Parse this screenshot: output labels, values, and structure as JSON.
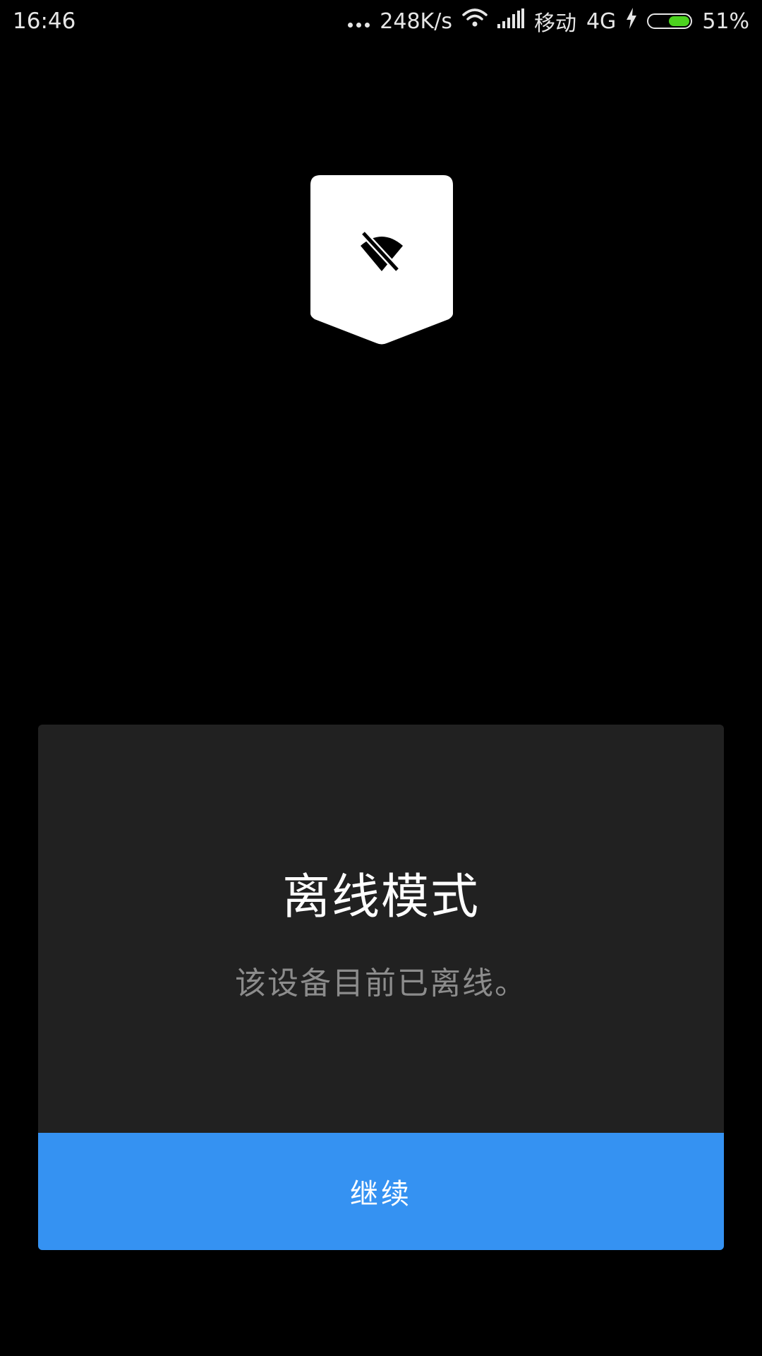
{
  "status_bar": {
    "time": "16:46",
    "network_speed": "248K/s",
    "carrier": "移动",
    "network_type": "4G",
    "battery_percent": "51%",
    "battery_level": 0.51,
    "battery_color": "#4cd21f",
    "icons": [
      "more-dots-icon",
      "wifi-icon",
      "signal-icon",
      "charging-bolt-icon",
      "battery-icon"
    ]
  },
  "hero": {
    "icon": "wifi-off-shield-icon"
  },
  "dialog": {
    "title": "离线模式",
    "message": "该设备目前已离线。",
    "continue_label": "继续",
    "accent_color": "#3592f2",
    "background_color": "#212121"
  }
}
